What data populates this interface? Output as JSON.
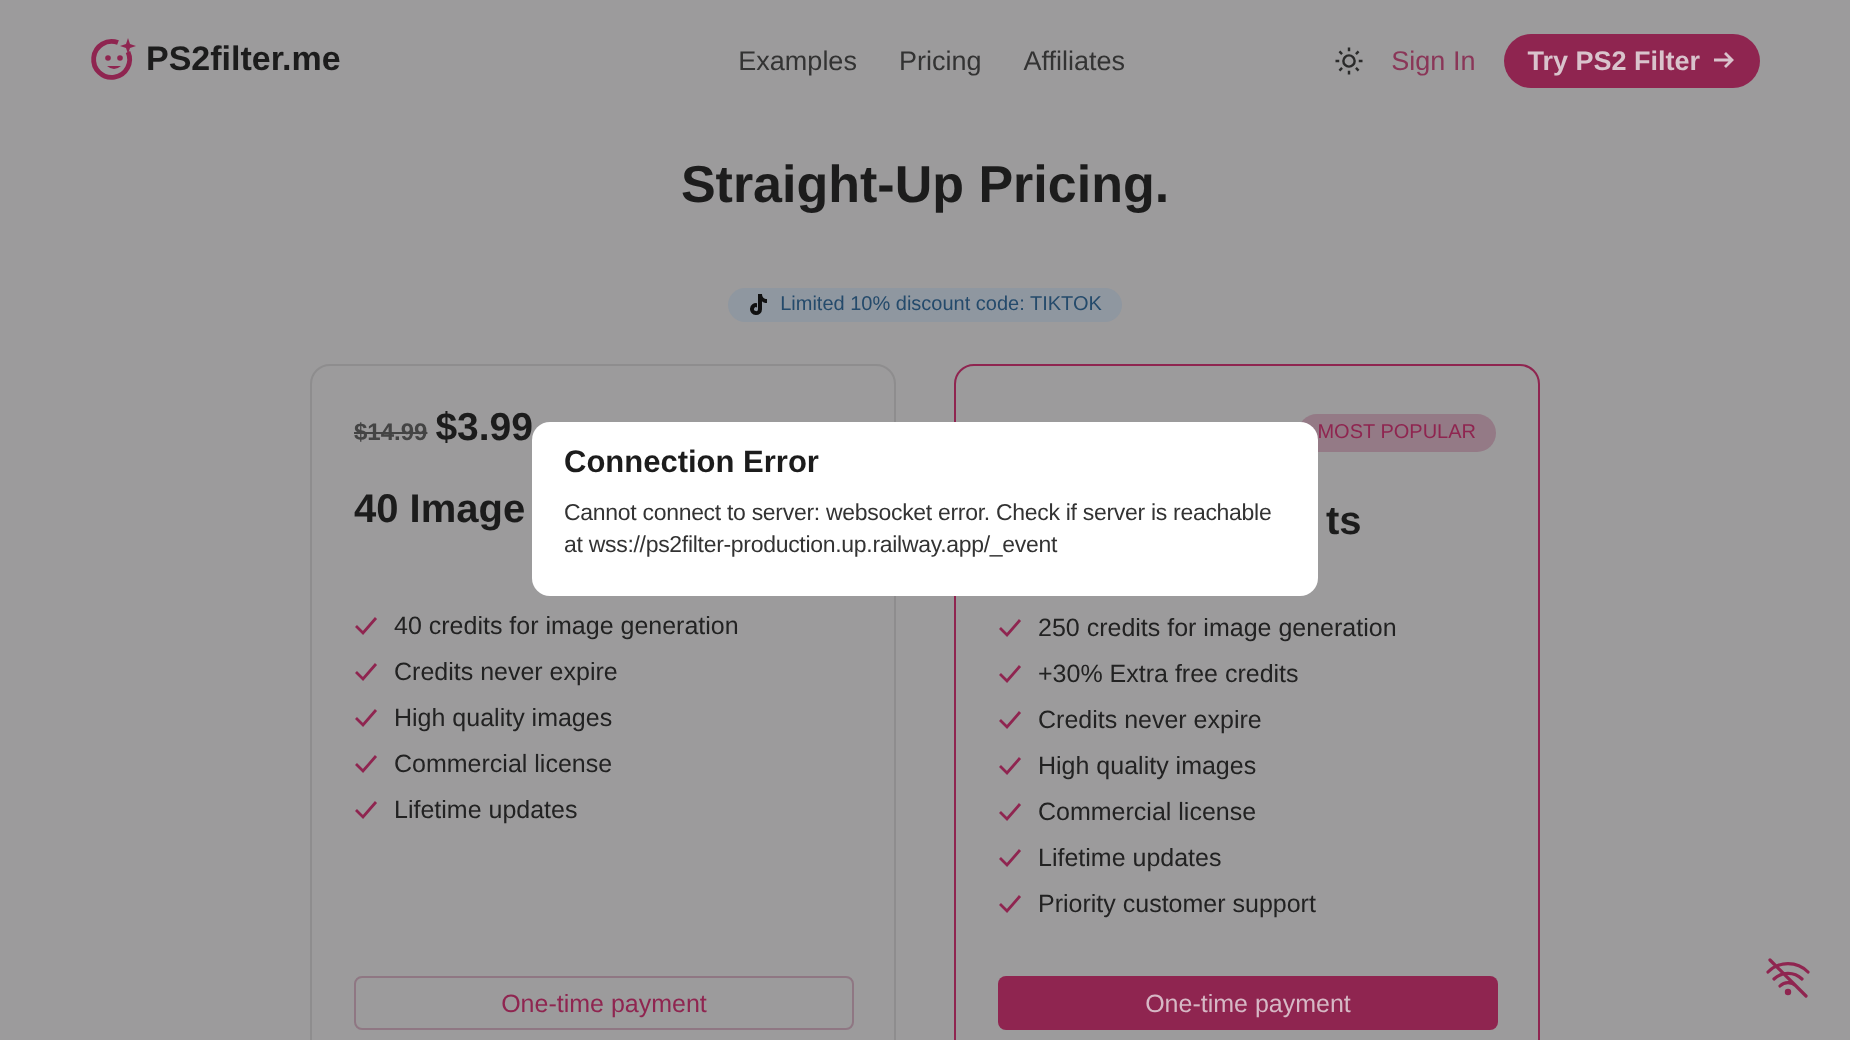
{
  "header": {
    "logo": "PS2filter.me",
    "nav": [
      {
        "label": "Examples"
      },
      {
        "label": "Pricing"
      },
      {
        "label": "Affiliates"
      }
    ],
    "sign_in": "Sign In",
    "cta": "Try PS2 Filter"
  },
  "heading": "Straight-Up Pricing.",
  "promo": "Limited 10% discount code: TIKTOK",
  "plans": [
    {
      "featured": false,
      "old_price": "$14.99",
      "price": "$3.99",
      "title": "40 Image",
      "features": [
        "40 credits for image generation",
        "Credits never expire",
        "High quality images",
        "Commercial license",
        "Lifetime updates"
      ],
      "button": {
        "label": "One-time payment",
        "kind": "outline"
      }
    },
    {
      "featured": true,
      "badge": "MOST POPULAR",
      "title": "ts",
      "features": [
        "250 credits for image generation",
        "+30% Extra free credits",
        "Credits never expire",
        "High quality images",
        "Commercial license",
        "Lifetime updates",
        "Priority customer support"
      ],
      "button": {
        "label": "One-time payment",
        "kind": "filled"
      }
    }
  ],
  "dialog": {
    "title": "Connection Error",
    "message": "Cannot connect to server: websocket error. Check if server is reachable at wss://ps2filter-production.up.railway.app/_event"
  }
}
